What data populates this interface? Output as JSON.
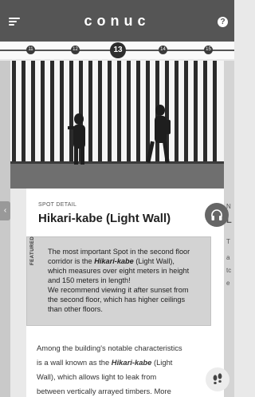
{
  "header": {
    "logo": "conuc",
    "help": "?"
  },
  "timeline": {
    "dots": [
      "11",
      "12",
      "13",
      "14",
      "15"
    ],
    "active": "13"
  },
  "spot": {
    "label": "SPOT DETAIL",
    "title": "Hikari-kabe (Light Wall)"
  },
  "featured": {
    "tag": "FEATURED",
    "lines": [
      "The most important Spot in the second floor",
      "corridor is the ",
      "Hikari-kabe",
      " (Light Wall),",
      "which measures over eight meters in height",
      "and 150 meters in length!",
      "We recommend viewing it after sunset from",
      "the second floor, which has higher ceilings",
      "than other floors."
    ]
  },
  "body": {
    "lines": [
      "Among the building's notable characteristics",
      "is a wall known as the ",
      "Hikari-kabe",
      " (Light",
      "Wall), which allows light to leak from",
      "between vertically arrayed timbers. More"
    ]
  },
  "side": {
    "peek_letters": [
      "N",
      "L",
      "T",
      "a",
      "tc",
      "e"
    ]
  },
  "colors": {
    "header": "#555555",
    "featured_bg": "#d3d3d3",
    "card": "#ffffff"
  }
}
